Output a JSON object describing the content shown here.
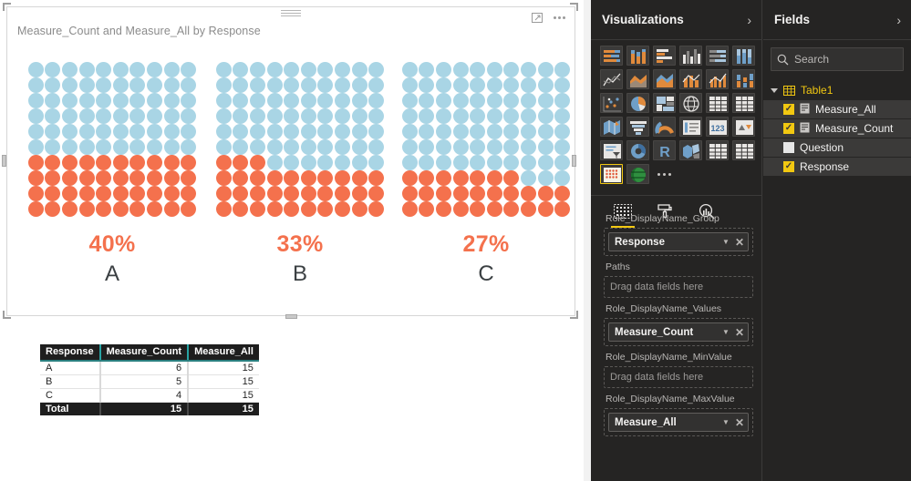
{
  "visual": {
    "title": "Measure_Count and Measure_All by Response",
    "expand_icon": "focus-mode-icon",
    "more_icon": "more-options-icon",
    "grip_icon": "drag-handle-icon"
  },
  "chart_data": {
    "type": "pictograph",
    "title": "Measure_Count and Measure_All by Response",
    "categories": [
      "A",
      "B",
      "C"
    ],
    "values": [
      6,
      5,
      4
    ],
    "totals": [
      15,
      15,
      15
    ],
    "percent_labels": [
      "40%",
      "33%",
      "27%"
    ],
    "percent_values": [
      40,
      33,
      27
    ],
    "grid_rows": 10,
    "grid_cols": 10,
    "filled_color": "#f4714d",
    "empty_color": "#a9d5e5",
    "label_color": "#3b4043",
    "legend": "none"
  },
  "table_visual": {
    "columns": [
      "Response",
      "Measure_Count",
      "Measure_All"
    ],
    "rows": [
      [
        "A",
        "6",
        "15"
      ],
      [
        "B",
        "5",
        "15"
      ],
      [
        "C",
        "4",
        "15"
      ]
    ],
    "total_row": [
      "Total",
      "15",
      "15"
    ]
  },
  "visualizations_pane": {
    "title": "Visualizations",
    "collapse_icon": "chevron-right-icon",
    "gallery": [
      {
        "name": "stacked-bar-chart-icon",
        "selected": false
      },
      {
        "name": "stacked-column-chart-icon",
        "selected": false
      },
      {
        "name": "clustered-bar-chart-icon",
        "selected": false
      },
      {
        "name": "clustered-column-chart-icon",
        "selected": false
      },
      {
        "name": "100-percent-stacked-bar-chart-icon",
        "selected": false
      },
      {
        "name": "100-percent-stacked-column-chart-icon",
        "selected": false
      },
      {
        "name": "line-chart-icon",
        "selected": false
      },
      {
        "name": "area-chart-icon",
        "selected": false
      },
      {
        "name": "stacked-area-chart-icon",
        "selected": false
      },
      {
        "name": "line-and-stacked-column-chart-icon",
        "selected": false
      },
      {
        "name": "line-and-clustered-column-chart-icon",
        "selected": false
      },
      {
        "name": "ribbon-chart-icon",
        "selected": false
      },
      {
        "name": "scatter-chart-icon",
        "selected": false
      },
      {
        "name": "pie-chart-icon",
        "selected": false
      },
      {
        "name": "treemap-icon",
        "selected": false
      },
      {
        "name": "map-icon",
        "selected": false
      },
      {
        "name": "matrix-icon",
        "selected": false
      },
      {
        "name": "table-icon",
        "selected": false
      },
      {
        "name": "filled-map-icon",
        "selected": false
      },
      {
        "name": "funnel-chart-icon",
        "selected": false
      },
      {
        "name": "gauge-chart-icon",
        "selected": false
      },
      {
        "name": "multi-row-card-icon",
        "selected": false
      },
      {
        "name": "card-icon",
        "selected": false
      },
      {
        "name": "kpi-icon",
        "selected": false
      },
      {
        "name": "slicer-icon",
        "selected": false
      },
      {
        "name": "donut-chart-icon",
        "selected": false
      },
      {
        "name": "r-script-visual-icon",
        "selected": false
      },
      {
        "name": "shape-map-icon",
        "selected": false
      },
      {
        "name": "matrix-alt-icon",
        "selected": false
      },
      {
        "name": "table-alt-icon",
        "selected": false
      },
      {
        "name": "pictograph-custom-visual-icon",
        "selected": true
      },
      {
        "name": "globe-map-custom-visual-icon",
        "selected": false
      },
      {
        "name": "more-visuals-icon",
        "selected": false
      }
    ],
    "tabs": [
      {
        "name": "fields-tab",
        "icon": "fields-grid-icon",
        "active": true
      },
      {
        "name": "format-tab",
        "icon": "paint-roller-icon",
        "active": false
      },
      {
        "name": "analytics-tab",
        "icon": "analytics-magnifier-icon",
        "active": false
      }
    ],
    "wells": [
      {
        "label": "Role_DisplayName_Group",
        "type": "chip",
        "value": "Response"
      },
      {
        "label": "Paths",
        "type": "empty",
        "value": "Drag data fields here"
      },
      {
        "label": "Role_DisplayName_Values",
        "type": "chip",
        "value": "Measure_Count"
      },
      {
        "label": "Role_DisplayName_MinValue",
        "type": "empty",
        "value": "Drag data fields here"
      },
      {
        "label": "Role_DisplayName_MaxValue",
        "type": "chip",
        "value": "Measure_All"
      }
    ],
    "highlight_color": "#e8262a"
  },
  "fields_pane": {
    "title": "Fields",
    "collapse_icon": "chevron-right-icon",
    "search_placeholder": "Search",
    "search_icon": "search-icon",
    "table_name": "Table1",
    "table_icon": "table-node-icon",
    "fields": [
      {
        "label": "Measure_All",
        "checked": true,
        "measure": true
      },
      {
        "label": "Measure_Count",
        "checked": true,
        "measure": true
      },
      {
        "label": "Question",
        "checked": false,
        "measure": false
      },
      {
        "label": "Response",
        "checked": true,
        "measure": false
      }
    ]
  }
}
